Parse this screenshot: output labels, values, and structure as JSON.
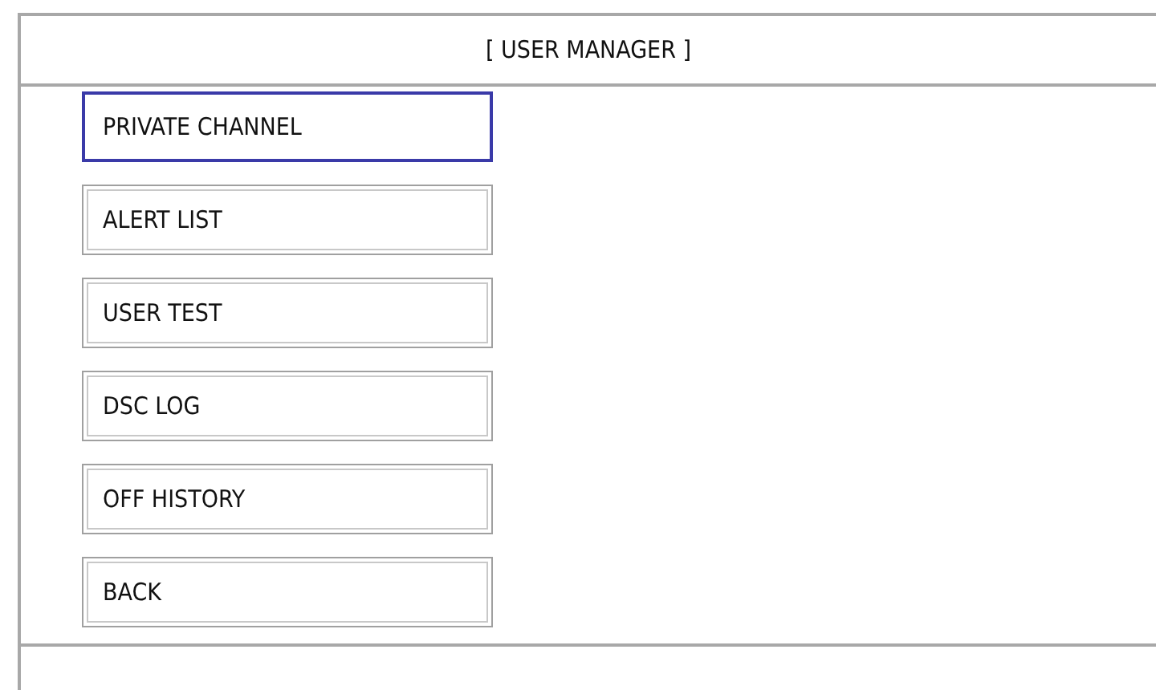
{
  "window": {
    "title": "[ USER MANAGER ]"
  },
  "menu": [
    {
      "label": "PRIVATE CHANNEL",
      "selected": true
    },
    {
      "label": "ALERT LIST",
      "selected": false
    },
    {
      "label": "USER TEST",
      "selected": false
    },
    {
      "label": "DSC LOG",
      "selected": false
    },
    {
      "label": "OFF HISTORY",
      "selected": false
    },
    {
      "label": "BACK",
      "selected": false
    }
  ]
}
